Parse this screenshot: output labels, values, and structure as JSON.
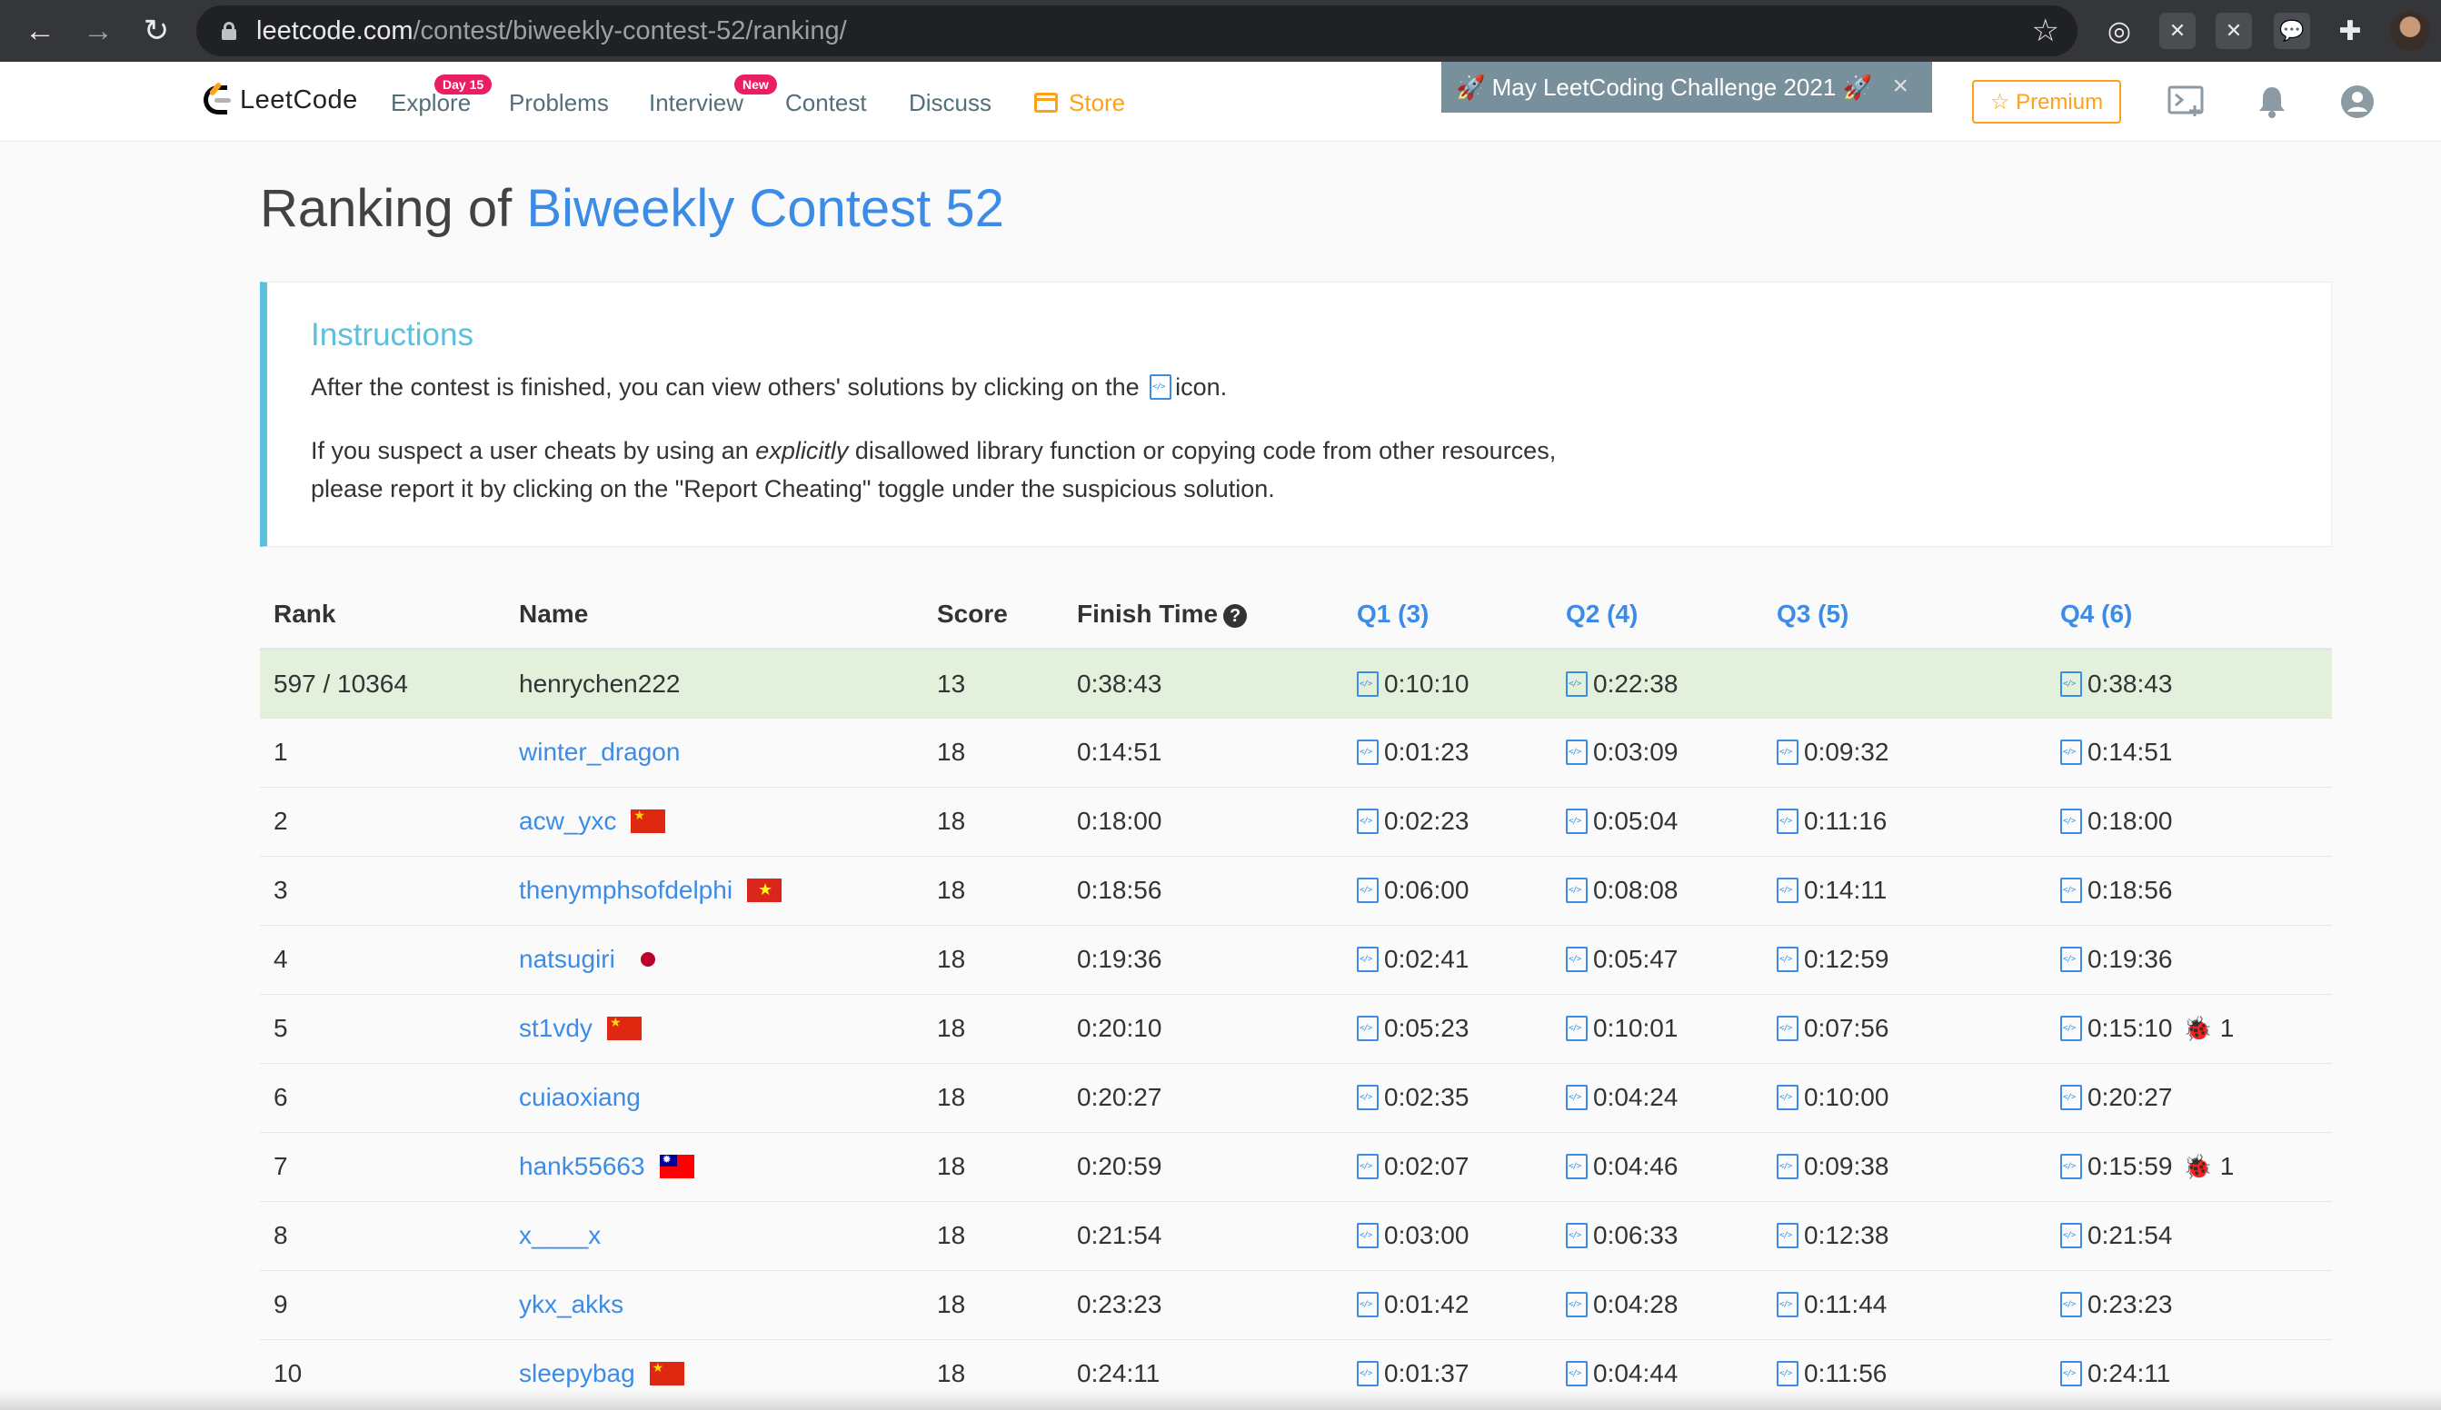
{
  "browser": {
    "url_host": "leetcode.com",
    "url_path": "/contest/biweekly-contest-52/ranking/"
  },
  "nav": {
    "logo_text": "LeetCode",
    "explore": "Explore",
    "explore_badge": "Day 15",
    "problems": "Problems",
    "interview": "Interview",
    "interview_badge": "New",
    "contest": "Contest",
    "discuss": "Discuss",
    "store": "Store",
    "challenge": "🚀 May LeetCoding Challenge 2021 🚀",
    "premium": "☆ Premium"
  },
  "page": {
    "title_prefix": "Ranking of ",
    "contest_name": "Biweekly Contest 52"
  },
  "instructions": {
    "title": "Instructions",
    "line1_before": "After the contest is finished, you can view others' solutions by clicking on the",
    "line1_after": "icon.",
    "line2_a": "If you suspect a user cheats by using an ",
    "line2_em": "explicitly",
    "line2_b": " disallowed library function or copying code from other resources,",
    "line3": "please report it by clicking on the \"Report Cheating\" toggle under the suspicious solution."
  },
  "table": {
    "headers": {
      "rank": "Rank",
      "name": "Name",
      "score": "Score",
      "finish": "Finish Time",
      "q1": "Q1 (3)",
      "q2": "Q2 (4)",
      "q3": "Q3 (5)",
      "q4": "Q4 (6)"
    },
    "rows": [
      {
        "rank": "597 / 10364",
        "name": "henrychen222",
        "flag": "",
        "score": "13",
        "finish": "0:38:43",
        "q1": "0:10:10",
        "q2": "0:22:38",
        "q3": "",
        "q4": "0:38:43",
        "bug4": ""
      },
      {
        "rank": "1",
        "name": "winter_dragon",
        "flag": "",
        "score": "18",
        "finish": "0:14:51",
        "q1": "0:01:23",
        "q2": "0:03:09",
        "q3": "0:09:32",
        "q4": "0:14:51",
        "bug4": ""
      },
      {
        "rank": "2",
        "name": "acw_yxc",
        "flag": "CN",
        "score": "18",
        "finish": "0:18:00",
        "q1": "0:02:23",
        "q2": "0:05:04",
        "q3": "0:11:16",
        "q4": "0:18:00",
        "bug4": ""
      },
      {
        "rank": "3",
        "name": "thenymphsofdelphi",
        "flag": "VN",
        "score": "18",
        "finish": "0:18:56",
        "q1": "0:06:00",
        "q2": "0:08:08",
        "q3": "0:14:11",
        "q4": "0:18:56",
        "bug4": ""
      },
      {
        "rank": "4",
        "name": "natsugiri",
        "flag": "JP",
        "score": "18",
        "finish": "0:19:36",
        "q1": "0:02:41",
        "q2": "0:05:47",
        "q3": "0:12:59",
        "q4": "0:19:36",
        "bug4": ""
      },
      {
        "rank": "5",
        "name": "st1vdy",
        "flag": "CN",
        "score": "18",
        "finish": "0:20:10",
        "q1": "0:05:23",
        "q2": "0:10:01",
        "q3": "0:07:56",
        "q4": "0:15:10",
        "bug4": "1"
      },
      {
        "rank": "6",
        "name": "cuiaoxiang",
        "flag": "",
        "score": "18",
        "finish": "0:20:27",
        "q1": "0:02:35",
        "q2": "0:04:24",
        "q3": "0:10:00",
        "q4": "0:20:27",
        "bug4": ""
      },
      {
        "rank": "7",
        "name": "hank55663",
        "flag": "TW",
        "score": "18",
        "finish": "0:20:59",
        "q1": "0:02:07",
        "q2": "0:04:46",
        "q3": "0:09:38",
        "q4": "0:15:59",
        "bug4": "1"
      },
      {
        "rank": "8",
        "name": "x____x",
        "flag": "",
        "score": "18",
        "finish": "0:21:54",
        "q1": "0:03:00",
        "q2": "0:06:33",
        "q3": "0:12:38",
        "q4": "0:21:54",
        "bug4": ""
      },
      {
        "rank": "9",
        "name": "ykx_akks",
        "flag": "",
        "score": "18",
        "finish": "0:23:23",
        "q1": "0:01:42",
        "q2": "0:04:28",
        "q3": "0:11:44",
        "q4": "0:23:23",
        "bug4": ""
      },
      {
        "rank": "10",
        "name": "sleepybag",
        "flag": "CN",
        "score": "18",
        "finish": "0:24:11",
        "q1": "0:01:37",
        "q2": "0:04:44",
        "q3": "0:11:56",
        "q4": "0:24:11",
        "bug4": ""
      }
    ]
  },
  "colors": {
    "accent": "#3c8ce7",
    "store": "#ffa116",
    "highlight_row": "#e3f0dc",
    "instructions": "#5bc0de"
  }
}
